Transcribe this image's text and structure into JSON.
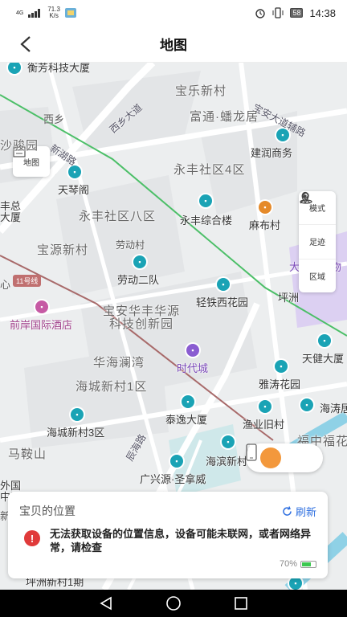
{
  "status_bar": {
    "network": "4G",
    "speed_value": "71.3",
    "speed_unit": "K/s",
    "battery": "58",
    "time": "14:38"
  },
  "app_bar": {
    "title": "地图"
  },
  "map": {
    "layer_button": "地图",
    "tools": [
      {
        "label": "模式",
        "icon": "person-icon"
      },
      {
        "label": "足迹",
        "icon": "footprint-pin-icon"
      },
      {
        "label": "区域",
        "icon": "area-pin-icon"
      }
    ],
    "metro_line": "11号线",
    "labels": {
      "hengfang": "衡芳科技大厦",
      "baole": "宝乐新村",
      "baoan_road": "宝安大道辅路",
      "xixiang_road": "西乡大道",
      "xixiang": "西乡",
      "futong": "富通·蟠龙居",
      "shajun": "沙骏园",
      "xinhu": "新湖路",
      "jianshe": "建润商务",
      "yongfeng4": "永丰社区4区",
      "tianqin": "天琴阁",
      "fengzong": "丰总",
      "dasha": "大厦",
      "yongfeng8": "永丰社区八区",
      "yongfeng_mall": "永丰综合楼",
      "mabu": "麻布村",
      "baoyuan": "宝源新村",
      "laodong": "劳动村",
      "laodong2": "劳动二队",
      "dashiqian": "大仟里购物",
      "xin": "心",
      "pingzhou": "坪洲",
      "qinggui": "轻铁西花园",
      "qianan": "前岸国际酒店",
      "huafeng1": "宝安华丰华源",
      "huafeng2": "科技创新园",
      "tianjian": "天健大厦",
      "huahai": "华海澜湾",
      "shidai": "时代城",
      "haicheng1": "海城新村1区",
      "yatao": "雅涛花园",
      "haibin_r": "海涛居",
      "taiyi": "泰逸大厦",
      "yuye": "渔业旧村",
      "haicheng3": "海城新村3区",
      "fuzhong": "福中福花",
      "maan": "马鞍山",
      "haibin": "海滨新村",
      "guangxing": "广兴源·圣拿威",
      "waiguo": "外国",
      "zhongguo": "中国",
      "xin2": "新",
      "pingzhou1": "坪洲新村1期",
      "chenhai": "辰海路"
    }
  },
  "location_card": {
    "title": "宝贝的位置",
    "refresh_label": "刷新",
    "message": "无法获取设备的位置信息，设备可能未联网，或者网络异常，请检查",
    "battery_percent": "70%",
    "battery_level": 0.7
  },
  "nav_bar": {
    "back": "back-triangle-icon",
    "home": "home-circle-icon",
    "recents": "recents-square-icon"
  }
}
